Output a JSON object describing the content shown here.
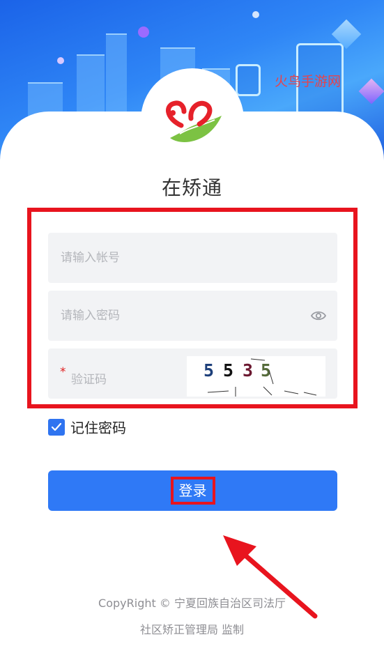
{
  "watermark": "火鸟手游网",
  "app_title": "在矫通",
  "account": {
    "placeholder": "请输入帐号",
    "value": ""
  },
  "password": {
    "placeholder": "请输入密码",
    "value": ""
  },
  "captcha": {
    "required_mark": "*",
    "label": "验证码",
    "chars": [
      "5",
      "5",
      "3",
      "5"
    ],
    "char_colors": [
      "#1d3f7a",
      "#111111",
      "#6b1830",
      "#556b3a"
    ]
  },
  "remember": {
    "label": "记住密码",
    "checked": true
  },
  "login_button": {
    "label": "登录"
  },
  "footer": {
    "copyright": "CopyRight © 宁夏回族自治区司法厅",
    "supervise": "社区矫正管理局 监制"
  },
  "colors": {
    "accent": "#2f79f6",
    "annotation": "#e8141e",
    "field_bg": "#f2f3f5"
  },
  "icons": [
    "logo-icon",
    "eye-icon",
    "checkmark-icon",
    "arrow-annotation-icon"
  ]
}
